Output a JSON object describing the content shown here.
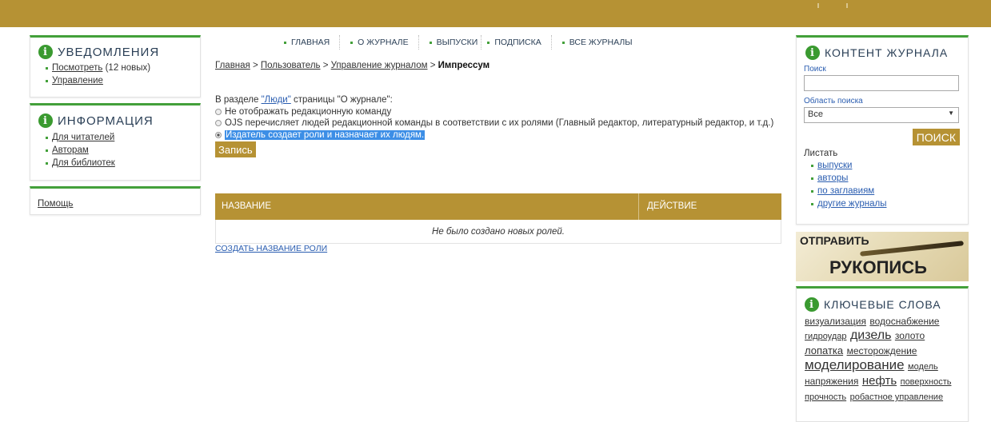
{
  "topbar": {
    "color": "#b69234"
  },
  "nav": {
    "items": [
      "ГЛАВНАЯ",
      "О ЖУРНАЛЕ",
      "ВЫПУСКИ",
      "ПОДПИСКА",
      "ВСЕ ЖУРНАЛЫ"
    ]
  },
  "left": {
    "notifications": {
      "title": "УВЕДОМЛЕНИЯ",
      "view_link": "Посмотреть",
      "view_count": " (12 новых)",
      "manage": "Управление"
    },
    "information": {
      "title": "ИНФОРМАЦИЯ",
      "items": [
        "Для читателей",
        "Авторам",
        "Для библиотек"
      ]
    },
    "help": "Помощь"
  },
  "breadcrumb": {
    "home": "Главная",
    "sep": " > ",
    "user": "Пользователь",
    "manage": "Управление журналом",
    "current": "Импрессум"
  },
  "content": {
    "intro_prefix": "В разделе ",
    "intro_link": "\"Люди\"",
    "intro_suffix": " страницы \"О журнале\":",
    "options": [
      "Не отображать редакционную команду",
      "OJS перечисляет людей редакционной команды в соответствии с их ролями (Главный редактор, литературный редактор, и т.д.)",
      "Издатель создает роли и назначает их людям."
    ],
    "selected_option": 3,
    "save_button": "Запись"
  },
  "table": {
    "columns": [
      "НАЗВАНИЕ",
      "ДЕЙСТВИЕ"
    ],
    "empty": "Не было создано новых ролей.",
    "create_link": "СОЗДАТЬ НАЗВАНИЕ РОЛИ"
  },
  "right": {
    "content": {
      "title": "КОНТЕНТ ЖУРНАЛА",
      "search_label": "Поиск",
      "search_value": "",
      "scope_label": "Область поиска",
      "scope_value": "Все",
      "search_button": "ПОИСК",
      "browse_label": "Листать",
      "browse_items": [
        "выпуски",
        "авторы",
        "по заглавиям",
        "другие журналы"
      ]
    },
    "submit_banner": {
      "line1": "ОТПРАВИТЬ",
      "line2": "РУКОПИСЬ"
    },
    "keywords": {
      "title": "КЛЮЧЕВЫЕ СЛОВА",
      "words": [
        {
          "text": "визуализация",
          "size": "m"
        },
        {
          "text": "водоснабжение",
          "size": "m"
        },
        {
          "text": "гидроудар",
          "size": "s"
        },
        {
          "text": "дизель",
          "size": "l"
        },
        {
          "text": "золото",
          "size": "m"
        },
        {
          "text": "лопатка",
          "size": "m"
        },
        {
          "text": "месторождение",
          "size": "m"
        },
        {
          "text": "моделирование",
          "size": "xl"
        },
        {
          "text": "модель",
          "size": "s"
        },
        {
          "text": "напряжения",
          "size": "m"
        },
        {
          "text": "нефть",
          "size": "l"
        },
        {
          "text": "поверхность",
          "size": "s"
        },
        {
          "text": "прочность",
          "size": "s"
        },
        {
          "text": "робастное управление",
          "size": "s"
        }
      ]
    }
  }
}
